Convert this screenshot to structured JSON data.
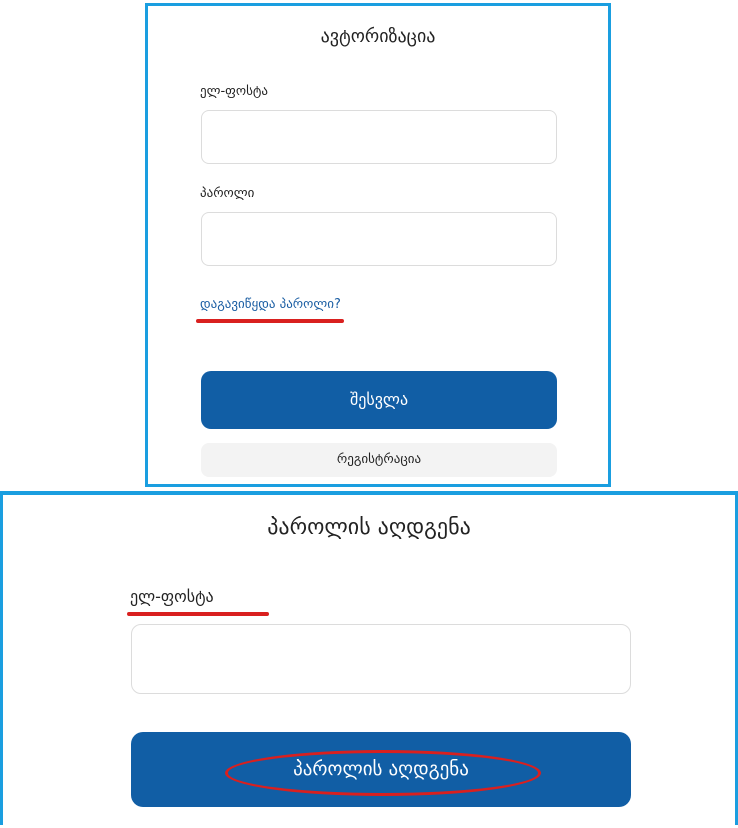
{
  "login": {
    "title": "ავტორიზაცია",
    "email_label": "ელ-ფოსტა",
    "email_value": "",
    "password_label": "პაროლი",
    "password_value": "",
    "forgot_link": "დაგავიწყდა პაროლი?",
    "submit_label": "შესვლა",
    "register_label": "რეგისტრაცია"
  },
  "recovery": {
    "title": "პაროლის აღდგენა",
    "email_label": "ელ-ფოსტა",
    "email_value": "",
    "submit_label": "პაროლის აღდგენა"
  },
  "colors": {
    "frame_border": "#1a9ee0",
    "primary_button": "#115ea5",
    "highlight_annotation": "#d9201f",
    "link": "#1b5ea3"
  }
}
